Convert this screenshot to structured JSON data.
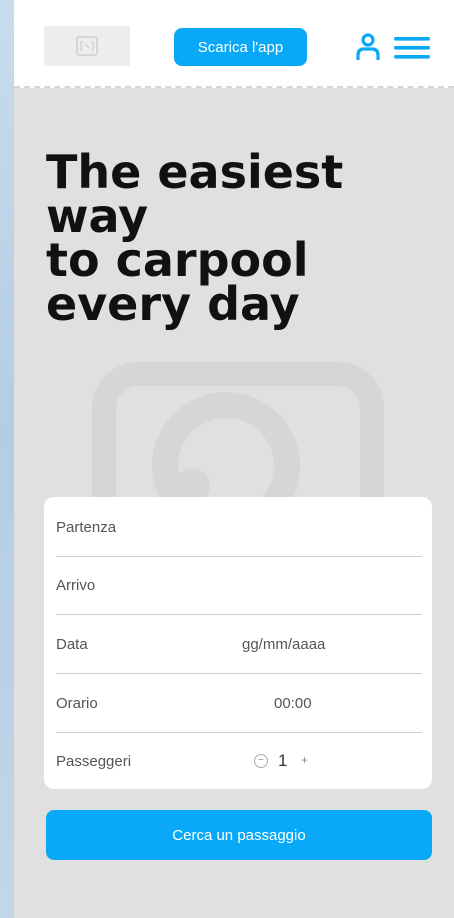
{
  "header": {
    "download_app_label": "Scarica l'app",
    "brand_color": "#0aa9f7",
    "user_icon": "user-icon",
    "menu_icon": "menu-icon"
  },
  "hero": {
    "title_lines": [
      "The easiest",
      "way",
      "to carpool",
      "every day"
    ]
  },
  "search_form": {
    "departure_label": "Partenza",
    "arrival_label": "Arrivo",
    "date_label": "Data",
    "date_placeholder": "gg/mm/aaaa",
    "time_label": "Orario",
    "time_placeholder": "00:00",
    "passengers_label": "Passeggeri",
    "passengers_value": "1",
    "decrement_symbol": "−",
    "increment_symbol": "+"
  },
  "search_button_label": "Cerca un passaggio"
}
